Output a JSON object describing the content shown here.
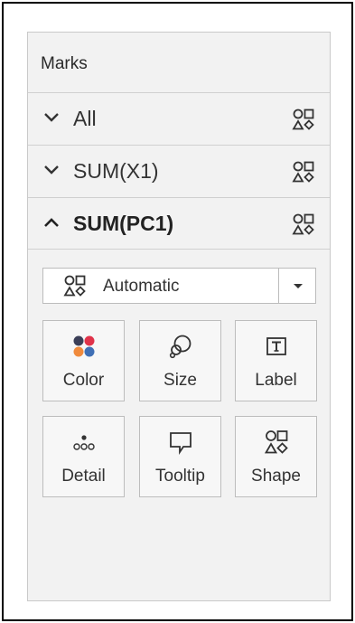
{
  "marks_card": {
    "title": "Marks",
    "rows": [
      {
        "label": "All",
        "expanded": false,
        "icon": "shape-icon"
      },
      {
        "label": "SUM(X1)",
        "expanded": false,
        "icon": "shape-icon"
      },
      {
        "label": "SUM(PC1)",
        "expanded": true,
        "icon": "shape-icon"
      }
    ],
    "mark_type": {
      "selected": "Automatic",
      "icon": "shape-icon"
    },
    "buttons": [
      {
        "label": "Color",
        "icon": "color-dots-icon"
      },
      {
        "label": "Size",
        "icon": "size-icon"
      },
      {
        "label": "Label",
        "icon": "label-text-icon"
      },
      {
        "label": "Detail",
        "icon": "detail-dots-icon"
      },
      {
        "label": "Tooltip",
        "icon": "tooltip-speech-icon"
      },
      {
        "label": "Shape",
        "icon": "shape-icon"
      }
    ],
    "colors": {
      "color_dot_dark": "#3b3f58",
      "color_dot_red": "#e0334a",
      "color_dot_orange": "#f08a3c",
      "color_dot_blue": "#3f6fb5",
      "panel_bg": "#f2f2f2",
      "border": "#c9c9c9"
    }
  }
}
